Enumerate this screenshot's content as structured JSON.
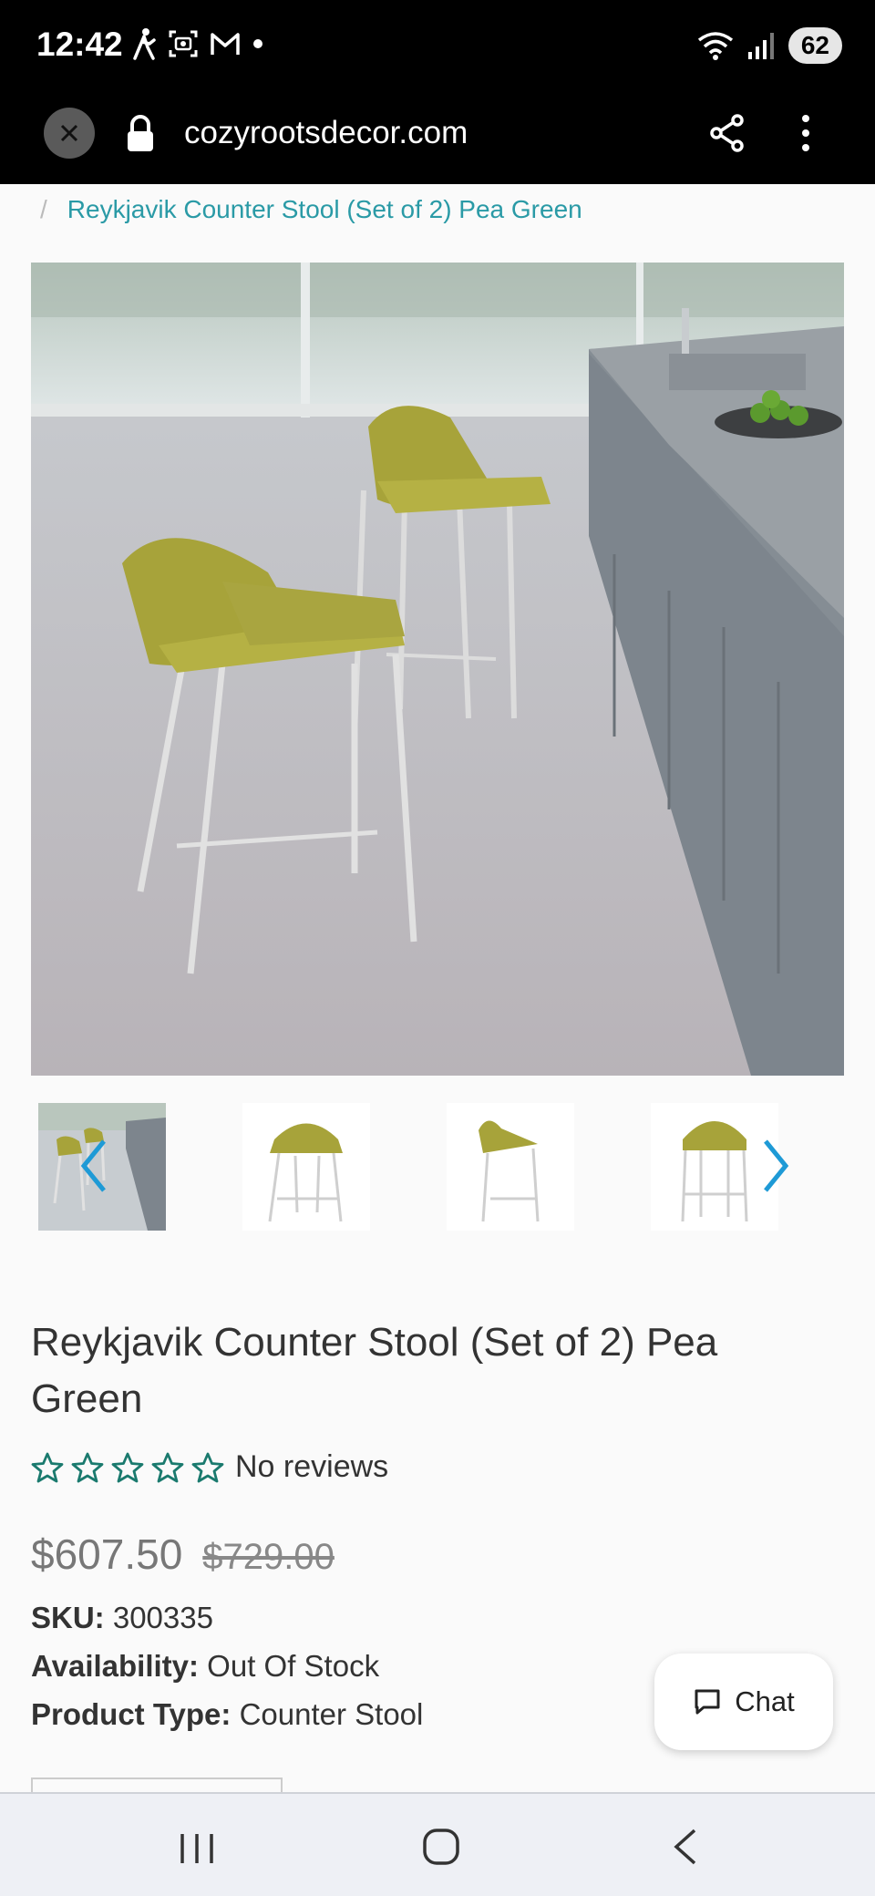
{
  "status_bar": {
    "time": "12:42",
    "battery": "62",
    "icons_left": [
      "walk-icon",
      "screenshot-icon",
      "mail-icon",
      "dot-icon"
    ],
    "icons_right": [
      "wifi-icon",
      "signal-icon",
      "battery-icon"
    ]
  },
  "browser": {
    "url": "cozyrootsdecor.com",
    "icons": [
      "close-icon",
      "lock-icon",
      "share-icon",
      "more-vertical-icon"
    ]
  },
  "breadcrumb": {
    "separator": "/",
    "current": "Reykjavik Counter Stool (Set of 2) Pea Green"
  },
  "product": {
    "title": "Reykjavik Counter Stool (Set of 2) Pea Green",
    "rating_stars": 0,
    "rating_max": 5,
    "reviews_text": "No reviews",
    "price": "$607.50",
    "compare_price": "$729.00",
    "sku_label": "SKU:",
    "sku_value": "300335",
    "availability_label": "Availability:",
    "availability_value": "Out Of Stock",
    "type_label": "Product Type:",
    "type_value": "Counter Stool"
  },
  "chat": {
    "label": "Chat"
  },
  "colors": {
    "accent": "#2a9aa6",
    "star": "#1a7a6e",
    "arrow": "#1e9ad6",
    "stool": "#a7a33a"
  }
}
